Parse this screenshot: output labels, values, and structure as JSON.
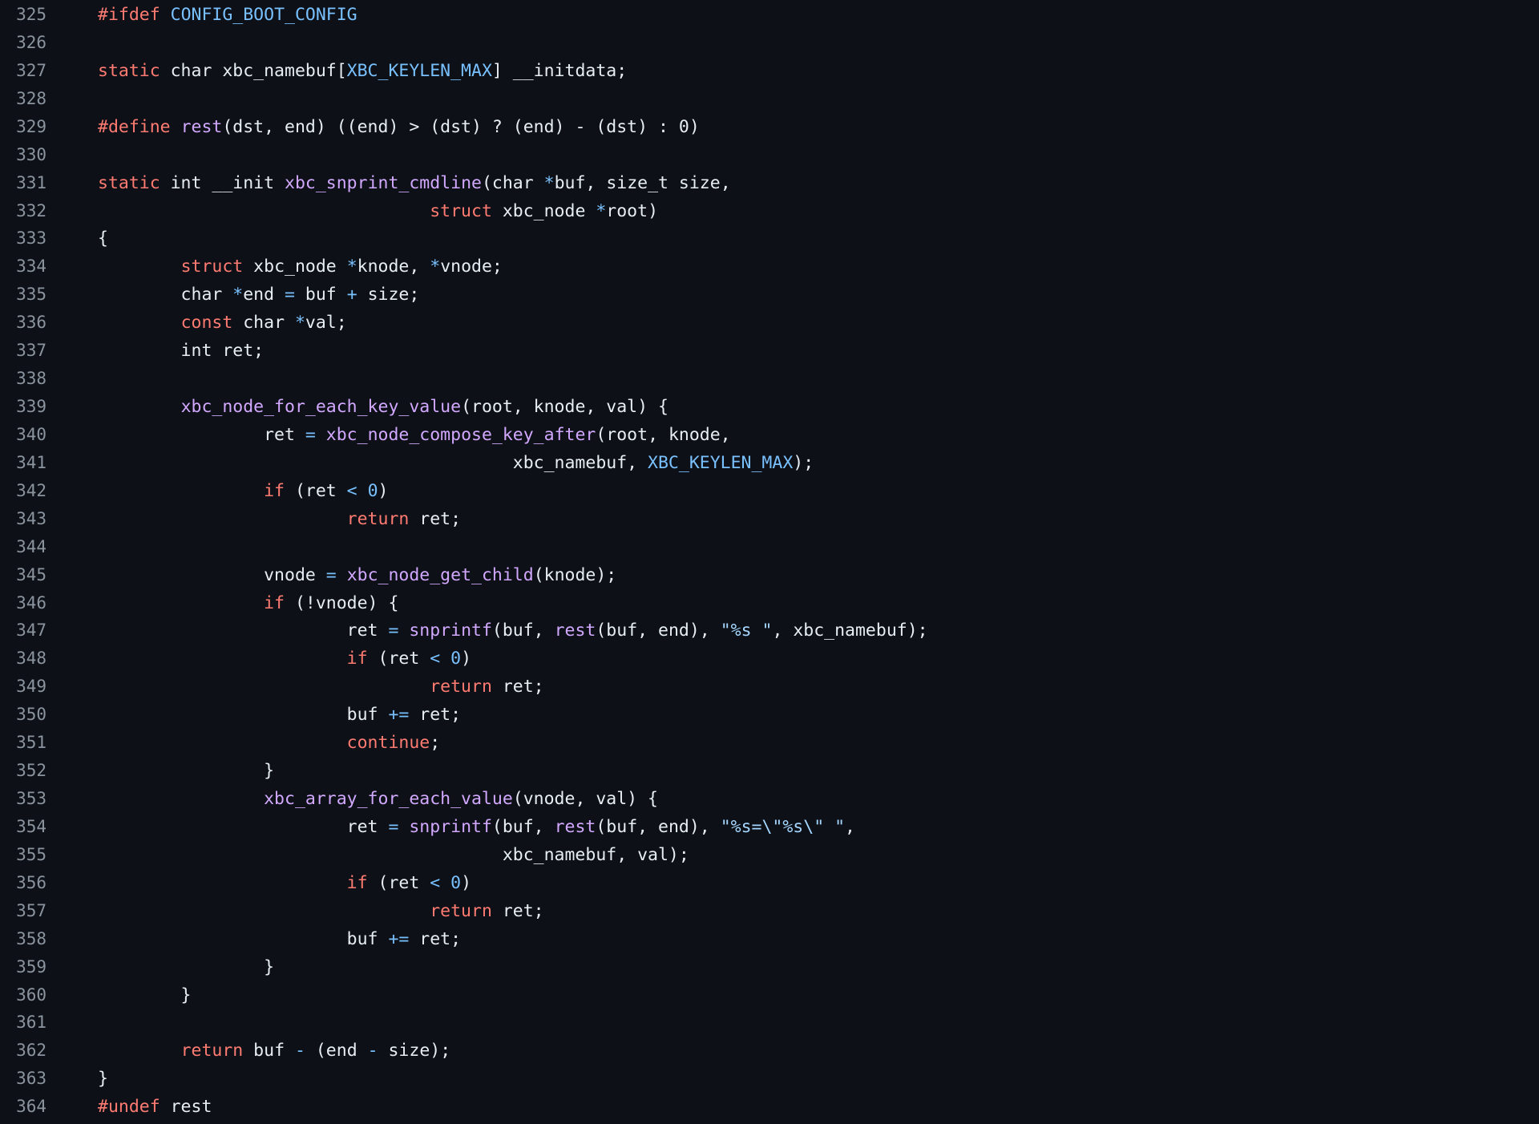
{
  "code_view": {
    "lines": [
      {
        "number": "325",
        "tokens": [
          {
            "t": "#ifdef",
            "c": "kw"
          },
          {
            "t": " ",
            "c": "id"
          },
          {
            "t": "CONFIG_BOOT_CONFIG",
            "c": "mac"
          }
        ]
      },
      {
        "number": "326",
        "tokens": []
      },
      {
        "number": "327",
        "tokens": [
          {
            "t": "static",
            "c": "kw"
          },
          {
            "t": " char xbc_namebuf[",
            "c": "id"
          },
          {
            "t": "XBC_KEYLEN_MAX",
            "c": "mac"
          },
          {
            "t": "] __initdata;",
            "c": "id"
          }
        ]
      },
      {
        "number": "328",
        "tokens": []
      },
      {
        "number": "329",
        "tokens": [
          {
            "t": "#define",
            "c": "kw"
          },
          {
            "t": " ",
            "c": "id"
          },
          {
            "t": "rest",
            "c": "fn"
          },
          {
            "t": "(dst, end) ((end) > (dst) ? (end) - (dst) : 0)",
            "c": "id"
          }
        ]
      },
      {
        "number": "330",
        "tokens": []
      },
      {
        "number": "331",
        "tokens": [
          {
            "t": "static",
            "c": "kw"
          },
          {
            "t": " int __init ",
            "c": "id"
          },
          {
            "t": "xbc_snprint_cmdline",
            "c": "fn"
          },
          {
            "t": "(char ",
            "c": "id"
          },
          {
            "t": "*",
            "c": "op"
          },
          {
            "t": "buf, size_t size,",
            "c": "id"
          }
        ]
      },
      {
        "number": "332",
        "tokens": [
          {
            "t": "                                ",
            "c": "id"
          },
          {
            "t": "struct",
            "c": "kw"
          },
          {
            "t": " xbc_node ",
            "c": "id"
          },
          {
            "t": "*",
            "c": "op"
          },
          {
            "t": "root)",
            "c": "id"
          }
        ]
      },
      {
        "number": "333",
        "tokens": [
          {
            "t": "{",
            "c": "id"
          }
        ]
      },
      {
        "number": "334",
        "tokens": [
          {
            "t": "        ",
            "c": "id"
          },
          {
            "t": "struct",
            "c": "kw"
          },
          {
            "t": " xbc_node ",
            "c": "id"
          },
          {
            "t": "*",
            "c": "op"
          },
          {
            "t": "knode, ",
            "c": "id"
          },
          {
            "t": "*",
            "c": "op"
          },
          {
            "t": "vnode;",
            "c": "id"
          }
        ]
      },
      {
        "number": "335",
        "tokens": [
          {
            "t": "        char ",
            "c": "id"
          },
          {
            "t": "*",
            "c": "op"
          },
          {
            "t": "end ",
            "c": "id"
          },
          {
            "t": "=",
            "c": "op"
          },
          {
            "t": " buf ",
            "c": "id"
          },
          {
            "t": "+",
            "c": "op"
          },
          {
            "t": " size;",
            "c": "id"
          }
        ]
      },
      {
        "number": "336",
        "tokens": [
          {
            "t": "        ",
            "c": "id"
          },
          {
            "t": "const",
            "c": "kw"
          },
          {
            "t": " char ",
            "c": "id"
          },
          {
            "t": "*",
            "c": "op"
          },
          {
            "t": "val;",
            "c": "id"
          }
        ]
      },
      {
        "number": "337",
        "tokens": [
          {
            "t": "        int ret;",
            "c": "id"
          }
        ]
      },
      {
        "number": "338",
        "tokens": []
      },
      {
        "number": "339",
        "tokens": [
          {
            "t": "        ",
            "c": "id"
          },
          {
            "t": "xbc_node_for_each_key_value",
            "c": "fn"
          },
          {
            "t": "(root, knode, val) {",
            "c": "id"
          }
        ]
      },
      {
        "number": "340",
        "tokens": [
          {
            "t": "                ret ",
            "c": "id"
          },
          {
            "t": "=",
            "c": "op"
          },
          {
            "t": " ",
            "c": "id"
          },
          {
            "t": "xbc_node_compose_key_after",
            "c": "fn"
          },
          {
            "t": "(root, knode,",
            "c": "id"
          }
        ]
      },
      {
        "number": "341",
        "tokens": [
          {
            "t": "                                        xbc_namebuf, ",
            "c": "id"
          },
          {
            "t": "XBC_KEYLEN_MAX",
            "c": "mac"
          },
          {
            "t": ");",
            "c": "id"
          }
        ]
      },
      {
        "number": "342",
        "tokens": [
          {
            "t": "                ",
            "c": "id"
          },
          {
            "t": "if",
            "c": "kw"
          },
          {
            "t": " (ret ",
            "c": "id"
          },
          {
            "t": "<",
            "c": "op"
          },
          {
            "t": " ",
            "c": "id"
          },
          {
            "t": "0",
            "c": "num"
          },
          {
            "t": ")",
            "c": "id"
          }
        ]
      },
      {
        "number": "343",
        "tokens": [
          {
            "t": "                        ",
            "c": "id"
          },
          {
            "t": "return",
            "c": "kw"
          },
          {
            "t": " ret;",
            "c": "id"
          }
        ]
      },
      {
        "number": "344",
        "tokens": []
      },
      {
        "number": "345",
        "tokens": [
          {
            "t": "                vnode ",
            "c": "id"
          },
          {
            "t": "=",
            "c": "op"
          },
          {
            "t": " ",
            "c": "id"
          },
          {
            "t": "xbc_node_get_child",
            "c": "fn"
          },
          {
            "t": "(knode);",
            "c": "id"
          }
        ]
      },
      {
        "number": "346",
        "tokens": [
          {
            "t": "                ",
            "c": "id"
          },
          {
            "t": "if",
            "c": "kw"
          },
          {
            "t": " (!vnode) {",
            "c": "id"
          }
        ]
      },
      {
        "number": "347",
        "tokens": [
          {
            "t": "                        ret ",
            "c": "id"
          },
          {
            "t": "=",
            "c": "op"
          },
          {
            "t": " ",
            "c": "id"
          },
          {
            "t": "snprintf",
            "c": "fn"
          },
          {
            "t": "(buf, ",
            "c": "id"
          },
          {
            "t": "rest",
            "c": "fn"
          },
          {
            "t": "(buf, end), ",
            "c": "id"
          },
          {
            "t": "\"%s \"",
            "c": "str"
          },
          {
            "t": ", xbc_namebuf);",
            "c": "id"
          }
        ]
      },
      {
        "number": "348",
        "tokens": [
          {
            "t": "                        ",
            "c": "id"
          },
          {
            "t": "if",
            "c": "kw"
          },
          {
            "t": " (ret ",
            "c": "id"
          },
          {
            "t": "<",
            "c": "op"
          },
          {
            "t": " ",
            "c": "id"
          },
          {
            "t": "0",
            "c": "num"
          },
          {
            "t": ")",
            "c": "id"
          }
        ]
      },
      {
        "number": "349",
        "tokens": [
          {
            "t": "                                ",
            "c": "id"
          },
          {
            "t": "return",
            "c": "kw"
          },
          {
            "t": " ret;",
            "c": "id"
          }
        ]
      },
      {
        "number": "350",
        "tokens": [
          {
            "t": "                        buf ",
            "c": "id"
          },
          {
            "t": "+=",
            "c": "op"
          },
          {
            "t": " ret;",
            "c": "id"
          }
        ]
      },
      {
        "number": "351",
        "tokens": [
          {
            "t": "                        ",
            "c": "id"
          },
          {
            "t": "continue",
            "c": "kw"
          },
          {
            "t": ";",
            "c": "id"
          }
        ]
      },
      {
        "number": "352",
        "tokens": [
          {
            "t": "                }",
            "c": "id"
          }
        ]
      },
      {
        "number": "353",
        "tokens": [
          {
            "t": "                ",
            "c": "id"
          },
          {
            "t": "xbc_array_for_each_value",
            "c": "fn"
          },
          {
            "t": "(vnode, val) {",
            "c": "id"
          }
        ]
      },
      {
        "number": "354",
        "tokens": [
          {
            "t": "                        ret ",
            "c": "id"
          },
          {
            "t": "=",
            "c": "op"
          },
          {
            "t": " ",
            "c": "id"
          },
          {
            "t": "snprintf",
            "c": "fn"
          },
          {
            "t": "(buf, ",
            "c": "id"
          },
          {
            "t": "rest",
            "c": "fn"
          },
          {
            "t": "(buf, end), ",
            "c": "id"
          },
          {
            "t": "\"%s=\\\"%s\\\" \"",
            "c": "str"
          },
          {
            "t": ",",
            "c": "id"
          }
        ]
      },
      {
        "number": "355",
        "tokens": [
          {
            "t": "                                       xbc_namebuf, val);",
            "c": "id"
          }
        ]
      },
      {
        "number": "356",
        "tokens": [
          {
            "t": "                        ",
            "c": "id"
          },
          {
            "t": "if",
            "c": "kw"
          },
          {
            "t": " (ret ",
            "c": "id"
          },
          {
            "t": "<",
            "c": "op"
          },
          {
            "t": " ",
            "c": "id"
          },
          {
            "t": "0",
            "c": "num"
          },
          {
            "t": ")",
            "c": "id"
          }
        ]
      },
      {
        "number": "357",
        "tokens": [
          {
            "t": "                                ",
            "c": "id"
          },
          {
            "t": "return",
            "c": "kw"
          },
          {
            "t": " ret;",
            "c": "id"
          }
        ]
      },
      {
        "number": "358",
        "tokens": [
          {
            "t": "                        buf ",
            "c": "id"
          },
          {
            "t": "+=",
            "c": "op"
          },
          {
            "t": " ret;",
            "c": "id"
          }
        ]
      },
      {
        "number": "359",
        "tokens": [
          {
            "t": "                }",
            "c": "id"
          }
        ]
      },
      {
        "number": "360",
        "tokens": [
          {
            "t": "        }",
            "c": "id"
          }
        ]
      },
      {
        "number": "361",
        "tokens": []
      },
      {
        "number": "362",
        "tokens": [
          {
            "t": "        ",
            "c": "id"
          },
          {
            "t": "return",
            "c": "kw"
          },
          {
            "t": " buf ",
            "c": "id"
          },
          {
            "t": "-",
            "c": "op"
          },
          {
            "t": " (end ",
            "c": "id"
          },
          {
            "t": "-",
            "c": "op"
          },
          {
            "t": " size);",
            "c": "id"
          }
        ]
      },
      {
        "number": "363",
        "tokens": [
          {
            "t": "}",
            "c": "id"
          }
        ]
      },
      {
        "number": "364",
        "tokens": [
          {
            "t": "#undef",
            "c": "kw"
          },
          {
            "t": " rest",
            "c": "id"
          }
        ]
      }
    ]
  }
}
